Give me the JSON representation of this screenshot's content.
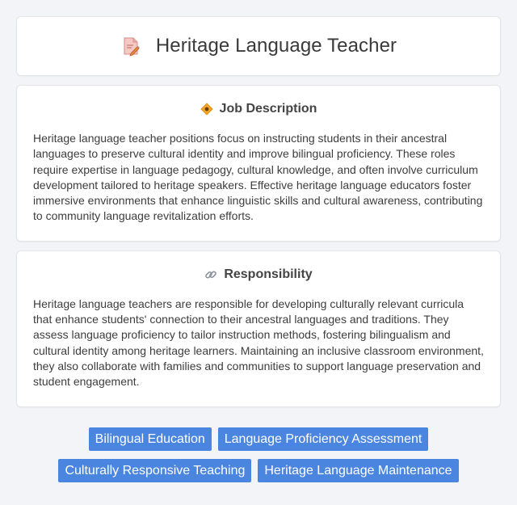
{
  "header": {
    "title": "Heritage Language Teacher",
    "icon": "document-pencil-icon"
  },
  "job_description": {
    "title": "Job Description",
    "icon": "diamond-badge-icon",
    "text": "Heritage language teacher positions focus on instructing students in their ancestral languages to preserve cultural identity and improve bilingual proficiency. These roles require expertise in language pedagogy, cultural knowledge, and often involve curriculum development tailored to heritage speakers. Effective heritage language educators foster immersive environments that enhance linguistic skills and cultural awareness, contributing to community language revitalization efforts."
  },
  "responsibility": {
    "title": "Responsibility",
    "icon": "link-icon",
    "text": "Heritage language teachers are responsible for developing culturally relevant curricula that enhance students' connection to their ancestral languages and traditions. They assess language proficiency to tailor instruction methods, fostering bilingualism and cultural identity among heritage learners. Maintaining an inclusive classroom environment, they also collaborate with families and communities to support language preservation and student engagement."
  },
  "tags": [
    "Bilingual Education",
    "Language Proficiency Assessment",
    "Culturally Responsive Teaching",
    "Heritage Language Maintenance"
  ],
  "colors": {
    "tag_background": "#4a86e0",
    "page_background": "#f3f4f7"
  }
}
